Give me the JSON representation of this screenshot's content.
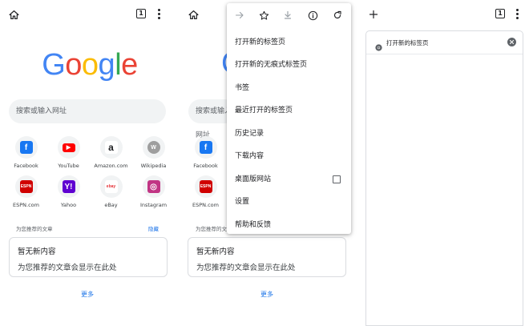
{
  "panel1": {
    "tab_count": "1",
    "logo": [
      "G",
      "o",
      "o",
      "g",
      "l",
      "e"
    ],
    "logo_colors": [
      "#4285F4",
      "#EA4335",
      "#FBBC05",
      "#4285F4",
      "#34A853",
      "#EA4335"
    ],
    "search_placeholder": "搜索或输入网址",
    "tiles": [
      {
        "label": "Facebook",
        "icon": "facebook-icon",
        "glyph": "f",
        "color": "#1877F2"
      },
      {
        "label": "YouTube",
        "icon": "youtube-icon",
        "glyph": "▶",
        "color": "#FF0000"
      },
      {
        "label": "Amazon.com",
        "icon": "amazon-icon",
        "glyph": "a",
        "color": "#ffffff"
      },
      {
        "label": "Wikipedia",
        "icon": "wikipedia-icon",
        "glyph": "W",
        "color": "#9e9e9e"
      },
      {
        "label": "ESPN.com",
        "icon": "espn-icon",
        "glyph": "ESPN",
        "color": "#D00000"
      },
      {
        "label": "Yahoo",
        "icon": "yahoo-icon",
        "glyph": "Y!",
        "color": "#5F01D1"
      },
      {
        "label": "eBay",
        "icon": "ebay-icon",
        "glyph": "ebay",
        "color": "#ffffff"
      },
      {
        "label": "Instagram",
        "icon": "instagram-icon",
        "glyph": "◎",
        "color": "#C13584"
      }
    ],
    "articles_label": "为您推荐的文章",
    "hide_label": "隐藏",
    "card_title": "暂无新内容",
    "card_body": "为您推荐的文章会显示在此处",
    "more_label": "更多"
  },
  "panel2": {
    "search_placeholder": "搜索或输入网址",
    "tiles": [
      {
        "label": "Facebook"
      },
      {
        "label": "ESPN.com"
      }
    ],
    "articles_label": "为您推荐的文",
    "card_title": "暂无新内容",
    "card_body": "为您推荐的文章会显示在此处",
    "more_label": "更多"
  },
  "menu": {
    "items": [
      "打开新的标签页",
      "打开新的无痕式标签页",
      "书签",
      "最近打开的标签页",
      "历史记录",
      "下载内容",
      "桌面版网站",
      "设置",
      "帮助和反馈"
    ],
    "desktop_site_checked": false
  },
  "panel3": {
    "tab_count": "1",
    "tab_title": "打开新的标签页"
  },
  "colors": {
    "accent": "#1a73e8",
    "search_bg": "#f1f3f4",
    "border": "#dadce0"
  }
}
